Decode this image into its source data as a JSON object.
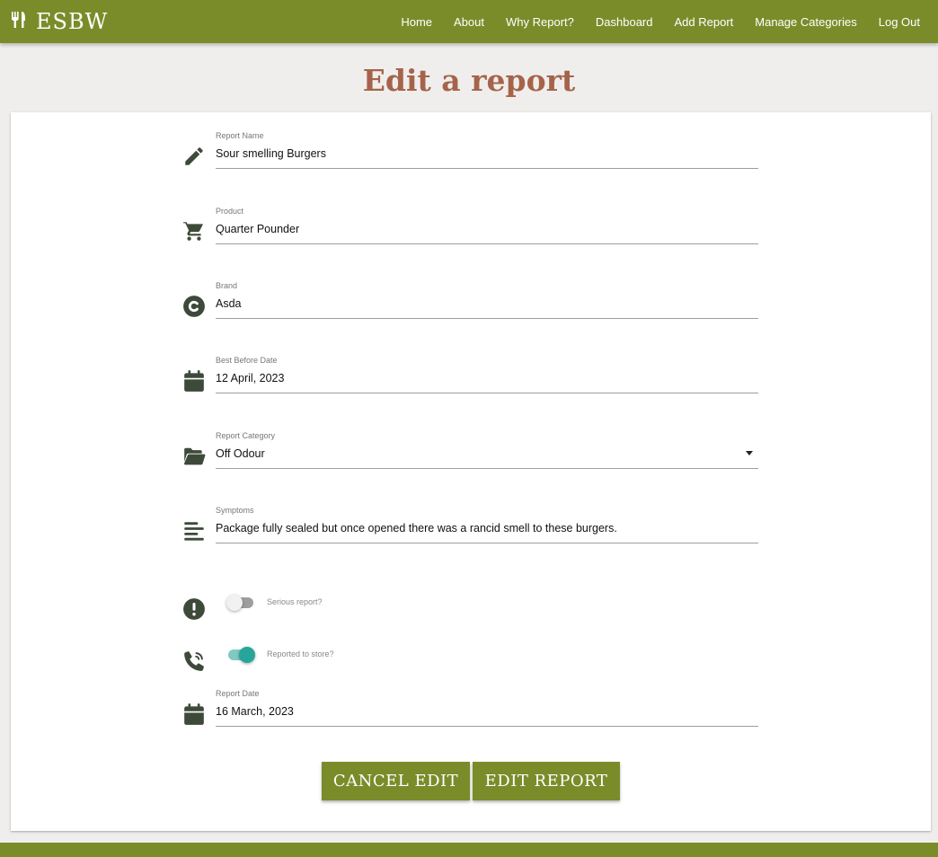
{
  "brand": {
    "name": "ESBW",
    "icon": "fork-knife-icon"
  },
  "nav": {
    "items": [
      "Home",
      "About",
      "Why Report?",
      "Dashboard",
      "Add Report",
      "Manage Categories",
      "Log Out"
    ]
  },
  "page": {
    "title": "Edit a report"
  },
  "form": {
    "report_name": {
      "label": "Report Name",
      "value": "Sour smelling Burgers",
      "icon": "pencil-icon"
    },
    "product": {
      "label": "Product",
      "value": "Quarter Pounder",
      "icon": "shopping-cart-icon"
    },
    "brand": {
      "label": "Brand",
      "value": "Asda",
      "icon": "copyright-icon"
    },
    "best_before": {
      "label": "Best Before Date",
      "value": "12 April, 2023",
      "icon": "calendar-icon"
    },
    "category": {
      "label": "Report Category",
      "value": "Off Odour",
      "icon": "folder-open-icon"
    },
    "symptoms": {
      "label": "Symptoms",
      "value": "Package fully sealed but once opened there was a rancid smell to these burgers.",
      "icon": "align-left-icon"
    },
    "serious": {
      "label": "Serious report?",
      "checked": false,
      "icon": "exclamation-circle-icon"
    },
    "reported_to_store": {
      "label": "Reported to store?",
      "checked": true,
      "icon": "phone-volume-icon"
    },
    "report_date": {
      "label": "Report Date",
      "value": "16 March, 2023",
      "icon": "calendar-icon"
    }
  },
  "buttons": {
    "cancel": "CANCEL EDIT",
    "submit": "EDIT REPORT"
  },
  "colors": {
    "primary": "#7a8c2a",
    "title": "#a5644a",
    "icon": "#3d4a3a",
    "toggle_on": "#26a69a"
  }
}
